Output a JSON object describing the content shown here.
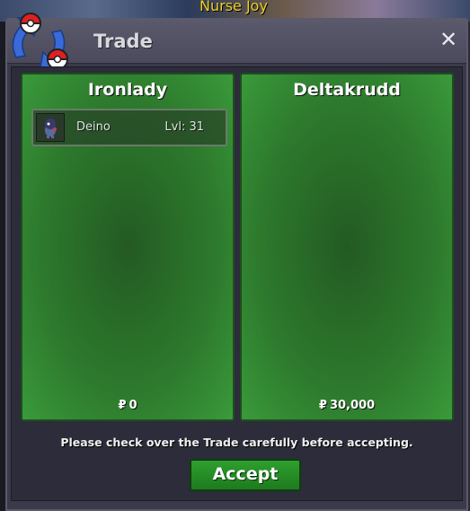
{
  "background": {
    "npc_name": "Nurse Joy"
  },
  "window": {
    "title": "Trade",
    "close_icon": "close-icon",
    "trade_icon": "pokeball-swap-icon"
  },
  "panels": {
    "left": {
      "player": "Ironlady",
      "items": [
        {
          "name": "Deino",
          "level": "Lvl: 31",
          "icon": "deino-sprite-icon"
        }
      ],
      "currency_symbol": "₽",
      "money": "0"
    },
    "right": {
      "player": "Deltakrudd",
      "items": [],
      "currency_symbol": "₽",
      "money": "30,000"
    }
  },
  "footer": {
    "notice": "Please check over the Trade carefully before accepting.",
    "accept_label": "Accept"
  },
  "colors": {
    "panel_green": "#2d7a2d",
    "accept_green": "#2ea02e",
    "window_bg": "#3a3a4a",
    "npc_name_color": "#f0d020"
  }
}
